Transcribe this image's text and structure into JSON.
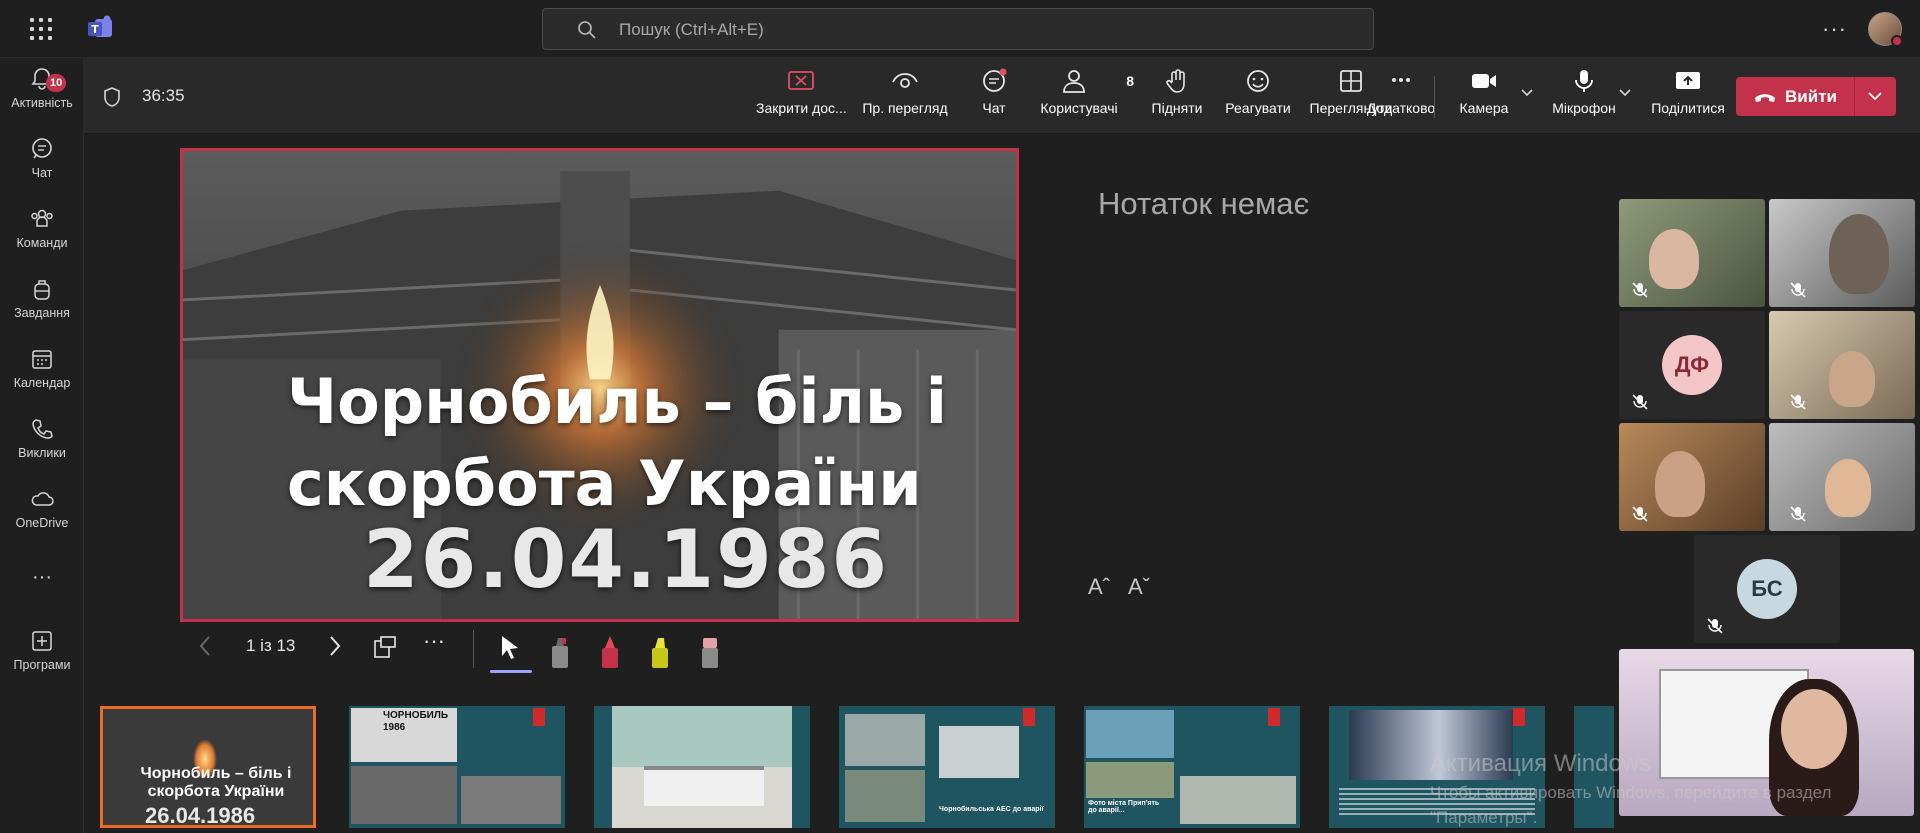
{
  "topbar": {
    "search_placeholder": "Пошук (Ctrl+Alt+E)",
    "more": "···"
  },
  "rail": {
    "items": [
      {
        "label": "Активність",
        "badge": "10"
      },
      {
        "label": "Чат"
      },
      {
        "label": "Команди"
      },
      {
        "label": "Завдання"
      },
      {
        "label": "Календар"
      },
      {
        "label": "Виклики"
      },
      {
        "label": "OneDrive"
      },
      {
        "label": "···"
      },
      {
        "label": "Програми"
      }
    ]
  },
  "toolbar": {
    "timer": "36:35",
    "close_share": "Закрити дос...",
    "preview": "Пр. перегляд",
    "chat": "Чат",
    "people": "Користувачі",
    "people_count": "8",
    "raise": "Підняти",
    "react": "Реагувати",
    "view": "Переглянути",
    "more": "Додатково",
    "camera": "Камера",
    "mic": "Мікрофон",
    "share": "Поділитися",
    "leave": "Вийти"
  },
  "slide": {
    "title_line1": "Чорнобиль – біль і",
    "title_line2": "скорбота України",
    "date": "26.04.1986"
  },
  "slide_controls": {
    "page": "1 із 13",
    "more": "···"
  },
  "notes": {
    "empty": "Нотаток немає",
    "font_up": "Aˆ",
    "font_down": "Aˇ"
  },
  "participants": [
    {
      "initials": "ДФ",
      "bg": "#f4c6c8",
      "fg": "#8b2a34"
    },
    {
      "initials": "БС",
      "bg": "#c8d8e0",
      "fg": "#2a3a44"
    }
  ],
  "thumbnails": {
    "active_title1": "Чорнобиль – біль і",
    "active_title2": "скорбота України",
    "active_date": "26.04.1986",
    "t2_title": "ЧОРНОБИЛЬ",
    "t2_year": "1986",
    "t4_caption": "Чорнобильська АЕС до аварії",
    "t5_caption": "Фото міста Прип'ять до аварії..."
  },
  "watermark": {
    "line1": "Активация Windows",
    "line2": "Чтобы активировать Windows, перейдите в раздел",
    "line3": "\"Параметры\"."
  },
  "colors": {
    "accent_red": "#c4314b",
    "thumb_active": "#e86c22",
    "teams_purple": "#5b5fc7"
  }
}
